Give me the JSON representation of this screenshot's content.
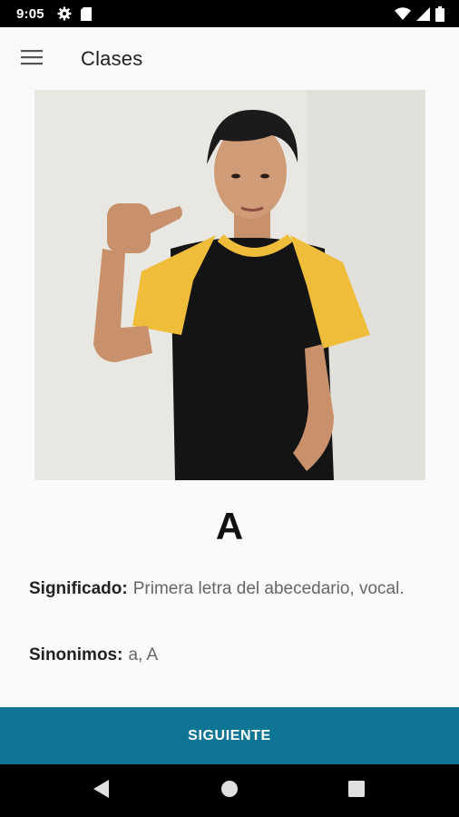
{
  "status_bar": {
    "time": "9:05",
    "icons": [
      "settings-icon",
      "sd-card-icon",
      "wifi-icon",
      "signal-icon",
      "battery-icon"
    ]
  },
  "app_bar": {
    "menu_icon": "hamburger-menu-icon",
    "title": "Clases"
  },
  "lesson": {
    "image_description_icon": "sign-language-photo",
    "letter": "A",
    "meaning_label": "Significado:",
    "meaning_value": "Primera letra del abecedario, vocal.",
    "synonyms_label": "Sinonimos:",
    "synonyms_value": "a, A"
  },
  "actions": {
    "next_label": "SIGUIENTE"
  },
  "nav_bar": {
    "buttons": [
      "back-icon",
      "home-icon",
      "recents-icon"
    ]
  },
  "colors": {
    "accent": "#0e7595",
    "status_bar": "#000000",
    "background": "#fafafa"
  }
}
